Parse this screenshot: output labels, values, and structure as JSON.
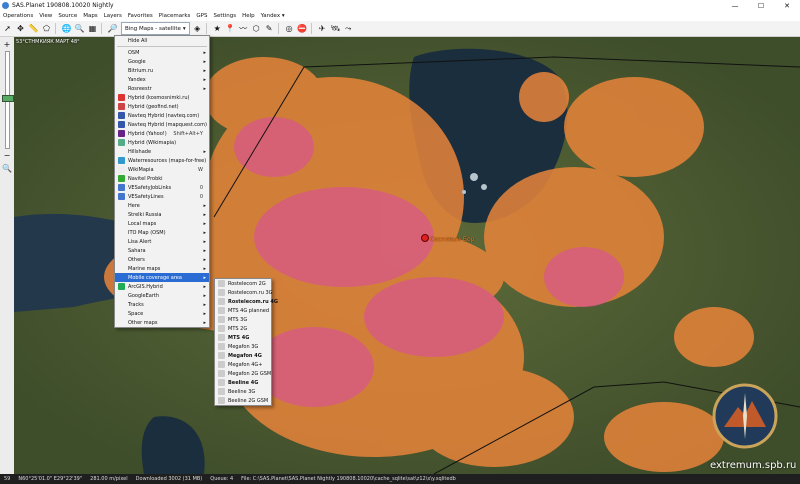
{
  "window": {
    "title": "SAS.Planet 190808.10020 Nightly",
    "controls": [
      "—",
      "☐",
      "✕"
    ]
  },
  "menubar": [
    "Operations",
    "View",
    "Source",
    "Maps",
    "Layers",
    "Favorites",
    "Placemarks",
    "GPS",
    "Settings",
    "Help",
    "Yandex ▾"
  ],
  "toolbar": {
    "layer_combo": "Bing Maps - satellite"
  },
  "map": {
    "coord_text": "53°СТНМКИЯК МАРТ 48°",
    "place_label": "Сосновый Бор"
  },
  "layers_menu": [
    {
      "label": "Hide All",
      "type": "item"
    },
    {
      "type": "sep"
    },
    {
      "label": "OSM",
      "arrow": true,
      "icon": ""
    },
    {
      "label": "Google",
      "arrow": true,
      "icon": ""
    },
    {
      "label": "Bitrium.ru",
      "arrow": true,
      "icon": ""
    },
    {
      "label": "Yandex",
      "arrow": true,
      "icon": ""
    },
    {
      "label": "Rosreestr",
      "arrow": true,
      "icon": ""
    },
    {
      "label": "Hybrid (kosmosnimki.ru)",
      "icon": "#d33"
    },
    {
      "label": "Hybrid (geofind.net)",
      "icon": "#c44"
    },
    {
      "label": "Navteq Hybrid (navteq.com)",
      "icon": "#35a"
    },
    {
      "label": "Navteq Hybrid (mapquest.com)",
      "icon": "#35a"
    },
    {
      "label": "Hybrid (Yahoo!)",
      "icon": "#628",
      "shortcut": "Shift+Alt+Y"
    },
    {
      "label": "Hybrid (Wikimapia)",
      "icon": "#5a8"
    },
    {
      "label": "Hillshade",
      "arrow": true,
      "icon": ""
    },
    {
      "label": "Waterresources (maps-for-free)",
      "icon": "#39c"
    },
    {
      "label": "WikiMapia",
      "icon": "#eee",
      "shortcut": "W"
    },
    {
      "label": "Navitel Probki",
      "icon": "#3a3"
    },
    {
      "label": "VESafetyJobLinks",
      "icon": "#47c",
      "shortcut": "0"
    },
    {
      "label": "VESafetyLines",
      "icon": "#47c",
      "shortcut": "0"
    },
    {
      "label": "Here",
      "arrow": true,
      "icon": ""
    },
    {
      "label": "Strelki Russia",
      "arrow": true,
      "icon": ""
    },
    {
      "label": "Local maps",
      "arrow": true,
      "icon": ""
    },
    {
      "label": "ITO Map (OSM)",
      "arrow": true,
      "icon": ""
    },
    {
      "label": "Lisa Alert",
      "arrow": true,
      "icon": ""
    },
    {
      "label": "Sahara",
      "arrow": true,
      "icon": ""
    },
    {
      "label": "Others",
      "arrow": true,
      "icon": ""
    },
    {
      "label": "Marine maps",
      "arrow": true,
      "icon": ""
    },
    {
      "label": "Mobile coverage area",
      "arrow": true,
      "icon": "",
      "highlight": true
    },
    {
      "label": "ArcGIS.Hybrid",
      "arrow": true,
      "icon": "#2a5"
    },
    {
      "label": "GoogleEarth",
      "arrow": true,
      "icon": ""
    },
    {
      "label": "Tracks",
      "arrow": true,
      "icon": ""
    },
    {
      "label": "Space",
      "arrow": true,
      "icon": ""
    },
    {
      "label": "Other maps",
      "arrow": true,
      "icon": ""
    }
  ],
  "coverage_menu": [
    {
      "label": "Rostelecom 2G",
      "icon": "#ccc"
    },
    {
      "label": "Rostelecom.ru 3G",
      "icon": "#ccc"
    },
    {
      "label": "Rostelecom.ru 4G",
      "icon": "#ccc",
      "bold": true
    },
    {
      "label": "MTS 4G planned",
      "icon": "#ccc"
    },
    {
      "label": "MTS 3G",
      "icon": "#ccc"
    },
    {
      "label": "MTS 2G",
      "icon": "#ccc"
    },
    {
      "label": "MTS 4G",
      "icon": "#ccc",
      "bold": true
    },
    {
      "label": "Megafon 3G",
      "icon": "#ccc"
    },
    {
      "label": "Megafon 4G",
      "icon": "#ccc",
      "bold": true
    },
    {
      "label": "Megafon 4G+",
      "icon": "#ccc"
    },
    {
      "label": "Megafon 2G GSM",
      "icon": "#ccc"
    },
    {
      "label": "Beeline 4G",
      "icon": "#ccc",
      "bold": true
    },
    {
      "label": "Beeline 3G",
      "icon": "#ccc"
    },
    {
      "label": "Beeline 2G GSM",
      "icon": "#ccc"
    }
  ],
  "statusbar": [
    "59",
    "N60°25'01.0\" E29°22'39\"",
    "281.00 m/pixel",
    "Downloaded 3002 (31 MB)",
    "Queue: 4",
    "File: C:\\SAS.Planet\\SAS.Planet Nightly 190808.10020\\cache_sqlite\\sat\\z12\\x\\y.sqlitedb"
  ],
  "watermark": "extremum.spb.ru",
  "colors": {
    "coverage_orange": "#e8843a",
    "coverage_pink": "#d8588a",
    "water": "#1f3545",
    "menu_highlight": "#2b6cd4"
  }
}
